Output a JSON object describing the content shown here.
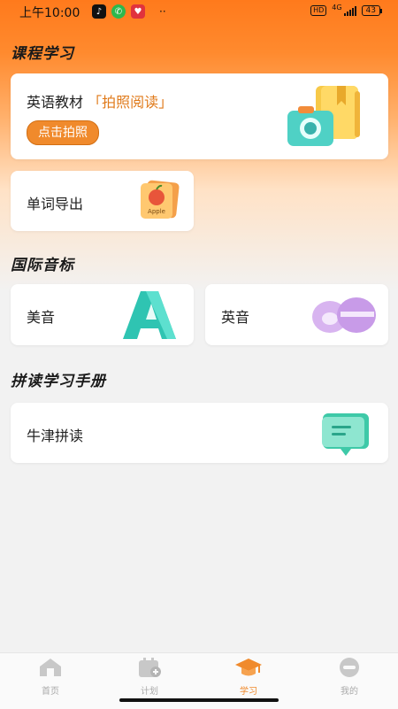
{
  "status_bar": {
    "time": "上午10:00",
    "network": "4G",
    "battery": "43"
  },
  "sections": {
    "course": "课程学习",
    "phonetic": "国际音标",
    "spelling": "拼读学习手册"
  },
  "cards": {
    "textbook": {
      "title": "英语教材",
      "tag": "「拍照阅读」",
      "button": "点击拍照"
    },
    "word_export": {
      "title": "单词导出",
      "illustration_text": "Apple"
    },
    "american": {
      "title": "美音"
    },
    "british": {
      "title": "英音"
    },
    "oxford": {
      "title": "牛津拼读"
    }
  },
  "tabbar": {
    "items": [
      {
        "label": "首页",
        "icon": "home-icon",
        "active": false
      },
      {
        "label": "计划",
        "icon": "calendar-plus-icon",
        "active": false
      },
      {
        "label": "学习",
        "icon": "graduation-cap-icon",
        "active": true
      },
      {
        "label": "我的",
        "icon": "profile-icon",
        "active": false
      }
    ]
  },
  "colors": {
    "accent": "#f08a2c",
    "header_gradient_top": "#ff7a1c",
    "background": "#f2f2f2"
  }
}
